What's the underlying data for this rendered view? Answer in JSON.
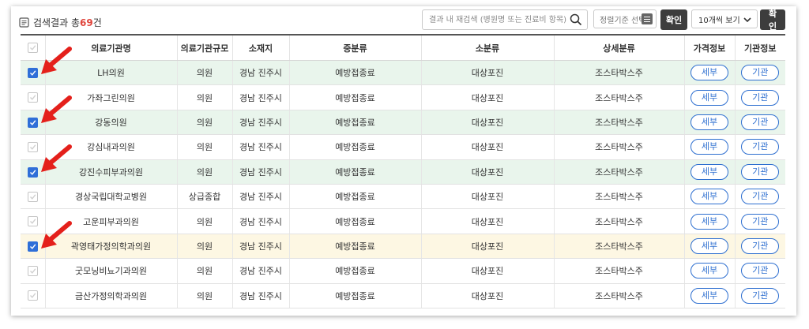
{
  "header": {
    "result_prefix": "검색결과 총",
    "result_count": "69",
    "result_suffix": "건",
    "search_placeholder": "결과 내 재검색 (병원명 또는 진료비 항목)",
    "sort_label": "정렬기준 선택",
    "confirm_label": "확인",
    "page_size_value": "10개씩 보기",
    "confirm2_label": "확인"
  },
  "table": {
    "columns": [
      "의료기관명",
      "의료기관규모",
      "소재지",
      "중분류",
      "소분류",
      "상세분류",
      "가격정보",
      "기관정보"
    ],
    "rows": [
      {
        "name": "LH의원",
        "size": "의원",
        "location": "경남 진주시",
        "mid": "예방접종료",
        "small": "대상포진",
        "detail": "조스타박스주",
        "price_btn": "세부",
        "org_btn": "기관",
        "checked": true,
        "highlight": "green"
      },
      {
        "name": "가좌그린의원",
        "size": "의원",
        "location": "경남 진주시",
        "mid": "예방접종료",
        "small": "대상포진",
        "detail": "조스타박스주",
        "price_btn": "세부",
        "org_btn": "기관",
        "checked": false,
        "highlight": "none"
      },
      {
        "name": "강동의원",
        "size": "의원",
        "location": "경남 진주시",
        "mid": "예방접종료",
        "small": "대상포진",
        "detail": "조스타박스주",
        "price_btn": "세부",
        "org_btn": "기관",
        "checked": true,
        "highlight": "green"
      },
      {
        "name": "강심내과의원",
        "size": "의원",
        "location": "경남 진주시",
        "mid": "예방접종료",
        "small": "대상포진",
        "detail": "조스타박스주",
        "price_btn": "세부",
        "org_btn": "기관",
        "checked": false,
        "highlight": "none"
      },
      {
        "name": "강진수피부과의원",
        "size": "의원",
        "location": "경남 진주시",
        "mid": "예방접종료",
        "small": "대상포진",
        "detail": "조스타박스주",
        "price_btn": "세부",
        "org_btn": "기관",
        "checked": true,
        "highlight": "green"
      },
      {
        "name": "경상국립대학교병원",
        "size": "상급종합",
        "location": "경남 진주시",
        "mid": "예방접종료",
        "small": "대상포진",
        "detail": "조스타박스주",
        "price_btn": "세부",
        "org_btn": "기관",
        "checked": false,
        "highlight": "none"
      },
      {
        "name": "고운피부과의원",
        "size": "의원",
        "location": "경남 진주시",
        "mid": "예방접종료",
        "small": "대상포진",
        "detail": "조스타박스주",
        "price_btn": "세부",
        "org_btn": "기관",
        "checked": false,
        "highlight": "none"
      },
      {
        "name": "곽영태가정의학과의원",
        "size": "의원",
        "location": "경남 진주시",
        "mid": "예방접종료",
        "small": "대상포진",
        "detail": "조스타박스주",
        "price_btn": "세부",
        "org_btn": "기관",
        "checked": true,
        "highlight": "yellow"
      },
      {
        "name": "굿모닝비뇨기과의원",
        "size": "의원",
        "location": "경남 진주시",
        "mid": "예방접종료",
        "small": "대상포진",
        "detail": "조스타박스주",
        "price_btn": "세부",
        "org_btn": "기관",
        "checked": false,
        "highlight": "none"
      },
      {
        "name": "금산가정의학과의원",
        "size": "의원",
        "location": "경남 진주시",
        "mid": "예방접종료",
        "small": "대상포진",
        "detail": "조스타박스주",
        "price_btn": "세부",
        "org_btn": "기관",
        "checked": false,
        "highlight": "none"
      }
    ]
  },
  "colors": {
    "accent_blue": "#2e6fd0",
    "count_red": "#e0463d",
    "highlight_green": "#e9f5ec",
    "highlight_yellow": "#fdf7e3",
    "arrow_red": "#e4201b",
    "dark_button": "#3d3d3d"
  },
  "icons": {
    "title": "document-icon",
    "search": "search-icon",
    "sort": "list-icon",
    "dropdown": "chevron-down-icon",
    "annotation": "red-arrow-icon"
  }
}
